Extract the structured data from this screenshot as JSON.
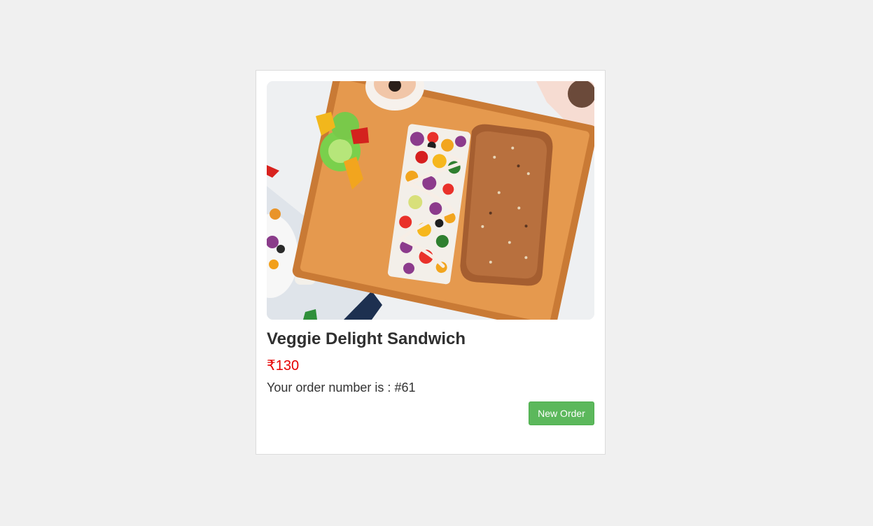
{
  "product": {
    "image_name": "veggie-delight-sandwich-photo",
    "name": "Veggie Delight Sandwich",
    "price": "₹130",
    "order_label": "Your order number is : ",
    "order_number": "#61"
  },
  "actions": {
    "new_order_label": "New Order"
  },
  "colors": {
    "page_background": "#f0f0f0",
    "card_background": "#ffffff",
    "price": "#e60000",
    "button": "#5cb85c"
  }
}
